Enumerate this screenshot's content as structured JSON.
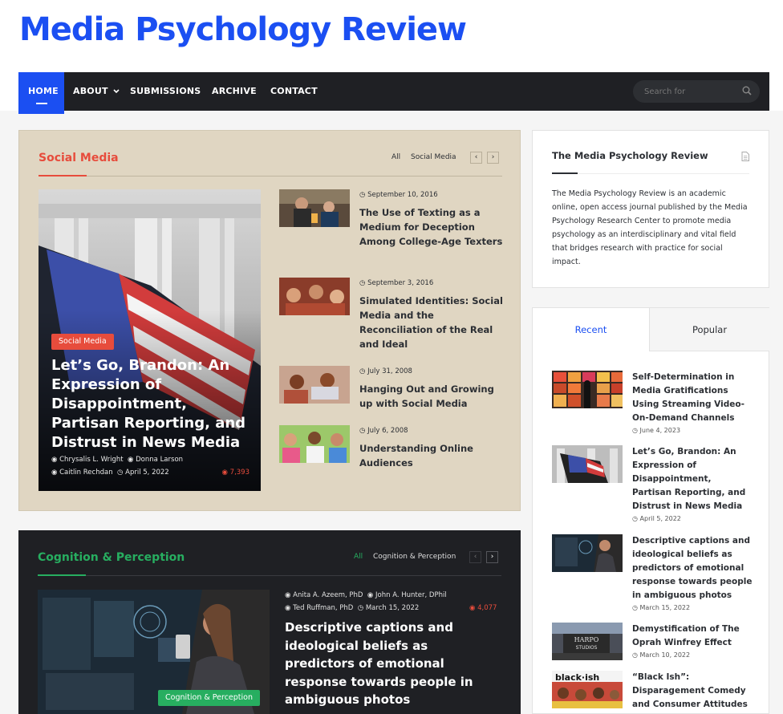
{
  "site": {
    "title": "Media Psychology Review"
  },
  "nav": {
    "items": [
      "HOME",
      "ABOUT",
      "SUBMISSIONS",
      "ARCHIVE",
      "CONTACT"
    ],
    "search_placeholder": "Search for"
  },
  "social": {
    "title": "Social Media",
    "accent": "#e74c3c",
    "filters": [
      "All",
      "Social Media"
    ],
    "featured": {
      "badge": "Social Media",
      "title": "Let’s Go, Brandon: An Expression of Disappointment, Partisan Reporting, and Distrust in News Media",
      "authors": [
        "Chrysalis L. Wright",
        "Donna Larson",
        "Caitlin Rechdan"
      ],
      "date": "April 5, 2022",
      "views": "7,393"
    },
    "posts": [
      {
        "date": "September 10, 2016",
        "title": "The Use of Texting as a Medium for Deception Among College-Age Texters"
      },
      {
        "date": "September 3, 2016",
        "title": "Simulated Identities: Social Media and the Reconciliation of the Real and Ideal"
      },
      {
        "date": "July 31, 2008",
        "title": "Hanging Out and Growing up with Social Media"
      },
      {
        "date": "July 6, 2008",
        "title": "Understanding Online Audiences"
      }
    ]
  },
  "cognition": {
    "title": "Cognition & Perception",
    "accent": "#27ae60",
    "filters": [
      "All",
      "Cognition & Perception"
    ],
    "featured": {
      "badge": "Cognition & Perception",
      "authors": [
        "Anita A. Azeem, PhD",
        "John A. Hunter, DPhil",
        "Ted Ruffman, PhD"
      ],
      "date": "March 15, 2022",
      "views": "4,077",
      "title": "Descriptive captions and ideological beliefs as predictors of emotional response towards people in ambiguous photos"
    }
  },
  "about": {
    "title": "The Media Psychology Review",
    "text": "The Media Psychology Review is an academic online, open access journal published by the Media Psychology Research Center to promote media psychology as an interdisciplinary and vital field that bridges research with practice for social impact."
  },
  "tabs": {
    "labels": [
      "Recent",
      "Popular"
    ],
    "recent": [
      {
        "title": "Self-Determination in Media Gratifications Using Streaming Video-On-Demand Channels",
        "date": "June 4, 2023"
      },
      {
        "title": "Let’s Go, Brandon: An Expression of Disappointment, Partisan Reporting, and Distrust in News Media",
        "date": "April 5, 2022"
      },
      {
        "title": "Descriptive captions and ideological beliefs as predictors of emotional response towards people in ambiguous photos",
        "date": "March 15, 2022"
      },
      {
        "title": "Demystification of The Oprah Winfrey Effect",
        "date": "March 10, 2022"
      },
      {
        "title": "“Black Ish”: Disparagement Comedy and Consumer Attitudes",
        "date": ""
      }
    ]
  }
}
